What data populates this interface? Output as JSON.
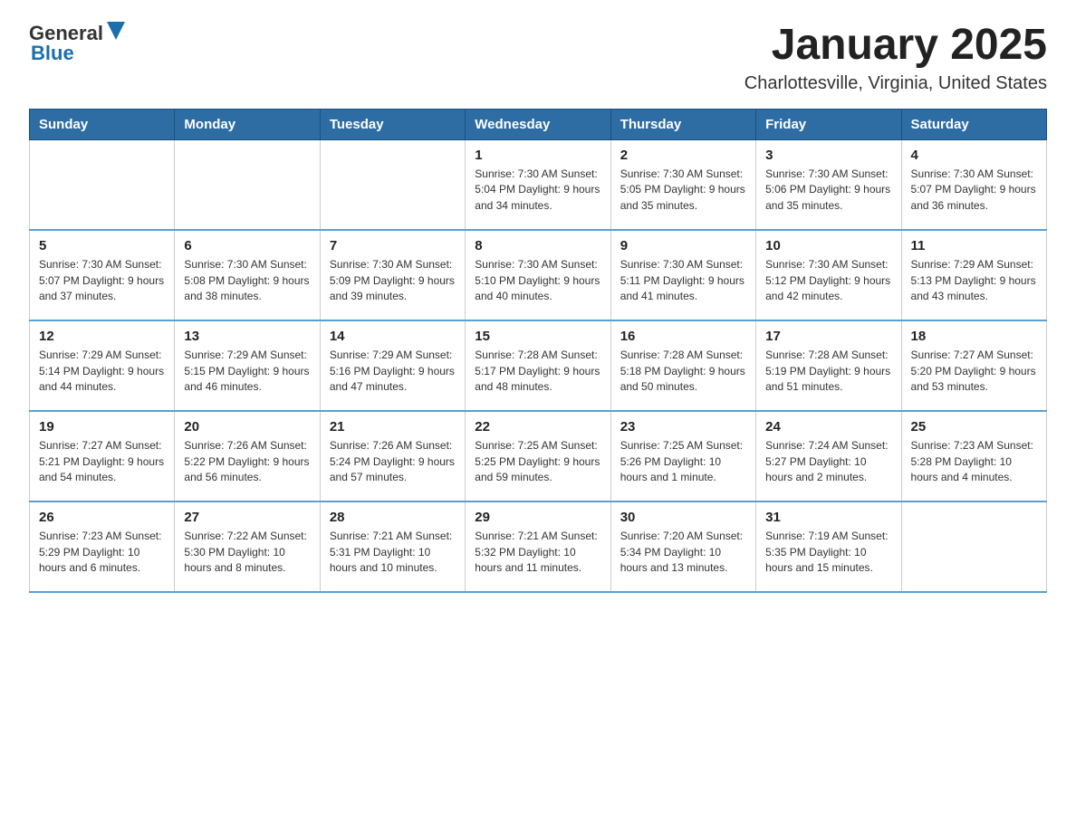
{
  "header": {
    "logo_general": "General",
    "logo_blue": "Blue",
    "month_title": "January 2025",
    "location": "Charlottesville, Virginia, United States"
  },
  "days_of_week": [
    "Sunday",
    "Monday",
    "Tuesday",
    "Wednesday",
    "Thursday",
    "Friday",
    "Saturday"
  ],
  "weeks": [
    [
      {
        "day": "",
        "info": ""
      },
      {
        "day": "",
        "info": ""
      },
      {
        "day": "",
        "info": ""
      },
      {
        "day": "1",
        "info": "Sunrise: 7:30 AM\nSunset: 5:04 PM\nDaylight: 9 hours\nand 34 minutes."
      },
      {
        "day": "2",
        "info": "Sunrise: 7:30 AM\nSunset: 5:05 PM\nDaylight: 9 hours\nand 35 minutes."
      },
      {
        "day": "3",
        "info": "Sunrise: 7:30 AM\nSunset: 5:06 PM\nDaylight: 9 hours\nand 35 minutes."
      },
      {
        "day": "4",
        "info": "Sunrise: 7:30 AM\nSunset: 5:07 PM\nDaylight: 9 hours\nand 36 minutes."
      }
    ],
    [
      {
        "day": "5",
        "info": "Sunrise: 7:30 AM\nSunset: 5:07 PM\nDaylight: 9 hours\nand 37 minutes."
      },
      {
        "day": "6",
        "info": "Sunrise: 7:30 AM\nSunset: 5:08 PM\nDaylight: 9 hours\nand 38 minutes."
      },
      {
        "day": "7",
        "info": "Sunrise: 7:30 AM\nSunset: 5:09 PM\nDaylight: 9 hours\nand 39 minutes."
      },
      {
        "day": "8",
        "info": "Sunrise: 7:30 AM\nSunset: 5:10 PM\nDaylight: 9 hours\nand 40 minutes."
      },
      {
        "day": "9",
        "info": "Sunrise: 7:30 AM\nSunset: 5:11 PM\nDaylight: 9 hours\nand 41 minutes."
      },
      {
        "day": "10",
        "info": "Sunrise: 7:30 AM\nSunset: 5:12 PM\nDaylight: 9 hours\nand 42 minutes."
      },
      {
        "day": "11",
        "info": "Sunrise: 7:29 AM\nSunset: 5:13 PM\nDaylight: 9 hours\nand 43 minutes."
      }
    ],
    [
      {
        "day": "12",
        "info": "Sunrise: 7:29 AM\nSunset: 5:14 PM\nDaylight: 9 hours\nand 44 minutes."
      },
      {
        "day": "13",
        "info": "Sunrise: 7:29 AM\nSunset: 5:15 PM\nDaylight: 9 hours\nand 46 minutes."
      },
      {
        "day": "14",
        "info": "Sunrise: 7:29 AM\nSunset: 5:16 PM\nDaylight: 9 hours\nand 47 minutes."
      },
      {
        "day": "15",
        "info": "Sunrise: 7:28 AM\nSunset: 5:17 PM\nDaylight: 9 hours\nand 48 minutes."
      },
      {
        "day": "16",
        "info": "Sunrise: 7:28 AM\nSunset: 5:18 PM\nDaylight: 9 hours\nand 50 minutes."
      },
      {
        "day": "17",
        "info": "Sunrise: 7:28 AM\nSunset: 5:19 PM\nDaylight: 9 hours\nand 51 minutes."
      },
      {
        "day": "18",
        "info": "Sunrise: 7:27 AM\nSunset: 5:20 PM\nDaylight: 9 hours\nand 53 minutes."
      }
    ],
    [
      {
        "day": "19",
        "info": "Sunrise: 7:27 AM\nSunset: 5:21 PM\nDaylight: 9 hours\nand 54 minutes."
      },
      {
        "day": "20",
        "info": "Sunrise: 7:26 AM\nSunset: 5:22 PM\nDaylight: 9 hours\nand 56 minutes."
      },
      {
        "day": "21",
        "info": "Sunrise: 7:26 AM\nSunset: 5:24 PM\nDaylight: 9 hours\nand 57 minutes."
      },
      {
        "day": "22",
        "info": "Sunrise: 7:25 AM\nSunset: 5:25 PM\nDaylight: 9 hours\nand 59 minutes."
      },
      {
        "day": "23",
        "info": "Sunrise: 7:25 AM\nSunset: 5:26 PM\nDaylight: 10 hours\nand 1 minute."
      },
      {
        "day": "24",
        "info": "Sunrise: 7:24 AM\nSunset: 5:27 PM\nDaylight: 10 hours\nand 2 minutes."
      },
      {
        "day": "25",
        "info": "Sunrise: 7:23 AM\nSunset: 5:28 PM\nDaylight: 10 hours\nand 4 minutes."
      }
    ],
    [
      {
        "day": "26",
        "info": "Sunrise: 7:23 AM\nSunset: 5:29 PM\nDaylight: 10 hours\nand 6 minutes."
      },
      {
        "day": "27",
        "info": "Sunrise: 7:22 AM\nSunset: 5:30 PM\nDaylight: 10 hours\nand 8 minutes."
      },
      {
        "day": "28",
        "info": "Sunrise: 7:21 AM\nSunset: 5:31 PM\nDaylight: 10 hours\nand 10 minutes."
      },
      {
        "day": "29",
        "info": "Sunrise: 7:21 AM\nSunset: 5:32 PM\nDaylight: 10 hours\nand 11 minutes."
      },
      {
        "day": "30",
        "info": "Sunrise: 7:20 AM\nSunset: 5:34 PM\nDaylight: 10 hours\nand 13 minutes."
      },
      {
        "day": "31",
        "info": "Sunrise: 7:19 AM\nSunset: 5:35 PM\nDaylight: 10 hours\nand 15 minutes."
      },
      {
        "day": "",
        "info": ""
      }
    ]
  ]
}
